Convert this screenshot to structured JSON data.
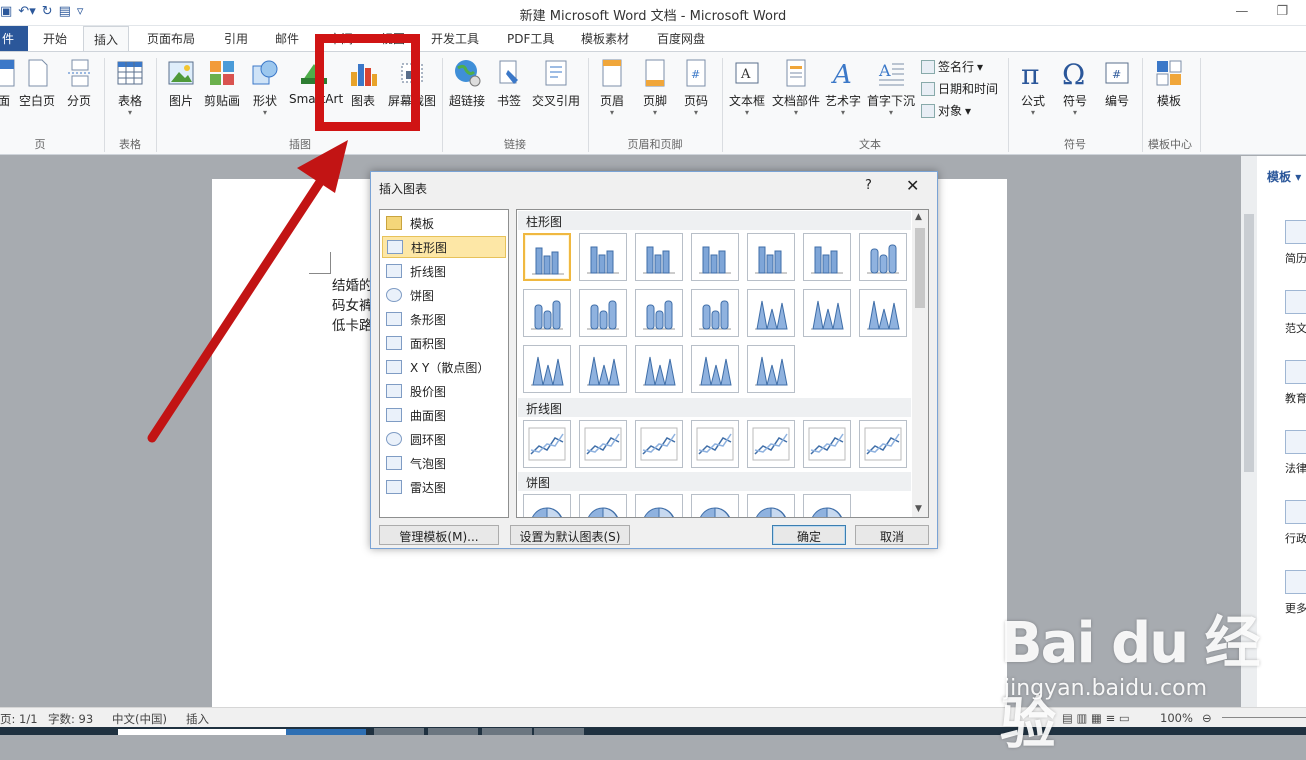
{
  "window": {
    "title": "新建 Microsoft Word 文档 - Microsoft Word"
  },
  "tabs": [
    "件",
    "开始",
    "插入",
    "页面布局",
    "引用",
    "邮件",
    "审阅",
    "视图",
    "开发工具",
    "PDF工具",
    "模板素材",
    "百度网盘"
  ],
  "ribbon": {
    "pages": {
      "buttons": [
        "面",
        "空白页",
        "分页"
      ],
      "label": "页"
    },
    "table": {
      "button": "表格",
      "label": "表格"
    },
    "illustrations": {
      "buttons": [
        "图片",
        "剪贴画",
        "形状",
        "SmartArt",
        "图表",
        "屏幕截图"
      ],
      "label": "插图"
    },
    "links": {
      "buttons": [
        "超链接",
        "书签",
        "交叉引用"
      ],
      "label": "链接"
    },
    "header_footer": {
      "buttons": [
        "页眉",
        "页脚",
        "页码"
      ],
      "label": "页眉和页脚"
    },
    "text": {
      "buttons": [
        "文本框",
        "文档部件",
        "艺术字",
        "首字下沉"
      ],
      "small": [
        "签名行",
        "日期和时间",
        "对象"
      ],
      "label": "文本"
    },
    "symbols": {
      "buttons": [
        "公式",
        "符号",
        "编号"
      ],
      "label": "符号"
    },
    "template": {
      "button": "模板",
      "label": "模板中心"
    }
  },
  "document": {
    "lines": [
      "结婚的",
      "码女裤",
      "低卡路"
    ]
  },
  "side_pane": {
    "title": "模板",
    "items": [
      "简历",
      "范文",
      "教育",
      "法律",
      "行政",
      "更多"
    ]
  },
  "dialog": {
    "title": "插入图表",
    "help": "?",
    "close": "✕",
    "categories": [
      "模板",
      "柱形图",
      "折线图",
      "饼图",
      "条形图",
      "面积图",
      "X Y（散点图）",
      "股价图",
      "曲面图",
      "圆环图",
      "气泡图",
      "雷达图"
    ],
    "selected_category": "柱形图",
    "sections": [
      "柱形图",
      "折线图",
      "饼图"
    ],
    "buttons": {
      "manage": "管理模板(M)...",
      "default": "设置为默认图表(S)",
      "ok": "确定",
      "cancel": "取消"
    }
  },
  "status": {
    "page": "页: 1/1",
    "words": "字数: 93",
    "lang": "中文(中国)",
    "mode": "插入",
    "zoom": "100%"
  },
  "watermark": {
    "brand": "Bai du 经验",
    "url": "jingyan.baidu.com"
  }
}
